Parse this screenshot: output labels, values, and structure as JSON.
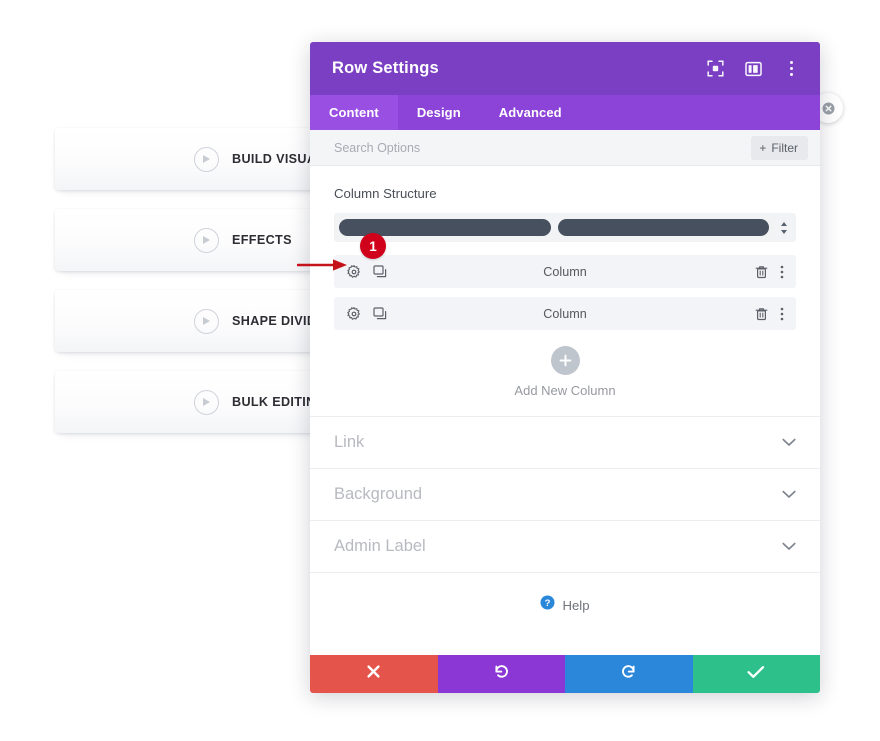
{
  "sidebar": {
    "items": [
      {
        "label": "BUILD VISUALLY",
        "icon": "play-circle-icon"
      },
      {
        "label": "EFFECTS",
        "icon": "play-circle-icon"
      },
      {
        "label": "SHAPE DIVIDERS",
        "icon": "play-circle-icon"
      },
      {
        "label": "BULK EDITING",
        "icon": "play-circle-icon"
      }
    ]
  },
  "modal": {
    "title": "Row Settings",
    "header_icons": [
      {
        "name": "focus-mode-icon"
      },
      {
        "name": "layout-split-icon"
      },
      {
        "name": "more-vertical-icon"
      }
    ],
    "tabs": [
      {
        "label": "Content",
        "active": true
      },
      {
        "label": "Design",
        "active": false
      },
      {
        "label": "Advanced",
        "active": false
      }
    ],
    "search": {
      "placeholder": "Search Options",
      "value": ""
    },
    "filter": {
      "label": "Filter",
      "plus": "+"
    },
    "column_structure": {
      "label": "Column Structure",
      "selected_preview": "two-equal-columns",
      "stepper_icon": "up-down-arrows-icon"
    },
    "columns": [
      {
        "name": "Column",
        "settings_icon": "gear-icon",
        "duplicate_icon": "duplicate-icon",
        "delete_icon": "trash-icon",
        "more_icon": "more-vertical-icon"
      },
      {
        "name": "Column",
        "settings_icon": "gear-icon",
        "duplicate_icon": "duplicate-icon",
        "delete_icon": "trash-icon",
        "more_icon": "more-vertical-icon"
      }
    ],
    "add_column": {
      "label": "Add New Column",
      "icon": "plus-icon"
    },
    "toggle_sections": [
      {
        "label": "Link",
        "icon": "chevron-down-icon"
      },
      {
        "label": "Background",
        "icon": "chevron-down-icon"
      },
      {
        "label": "Admin Label",
        "icon": "chevron-down-icon"
      }
    ],
    "help": {
      "label": "Help",
      "icon": "question-mark-icon"
    },
    "actions": [
      {
        "name": "cancel",
        "icon": "close-x-icon",
        "color": "#e5544b"
      },
      {
        "name": "undo",
        "icon": "undo-arrow-icon",
        "color": "#8b37d6"
      },
      {
        "name": "redo",
        "icon": "redo-arrow-icon",
        "color": "#2b87da"
      },
      {
        "name": "save",
        "icon": "checkmark-icon",
        "color": "#2ec08a"
      }
    ],
    "close_button": {
      "icon": "close-circle-icon"
    }
  },
  "annotations": {
    "badge": {
      "number": "1"
    },
    "arrow": {
      "name": "red-pointer-arrow",
      "color": "#c4121a"
    }
  },
  "colors": {
    "header_purple": "#7b3fc4",
    "tabbar_purple": "#8c43d8",
    "tab_active_purple": "#9a4fe3",
    "annotation_red": "#d0021b"
  }
}
